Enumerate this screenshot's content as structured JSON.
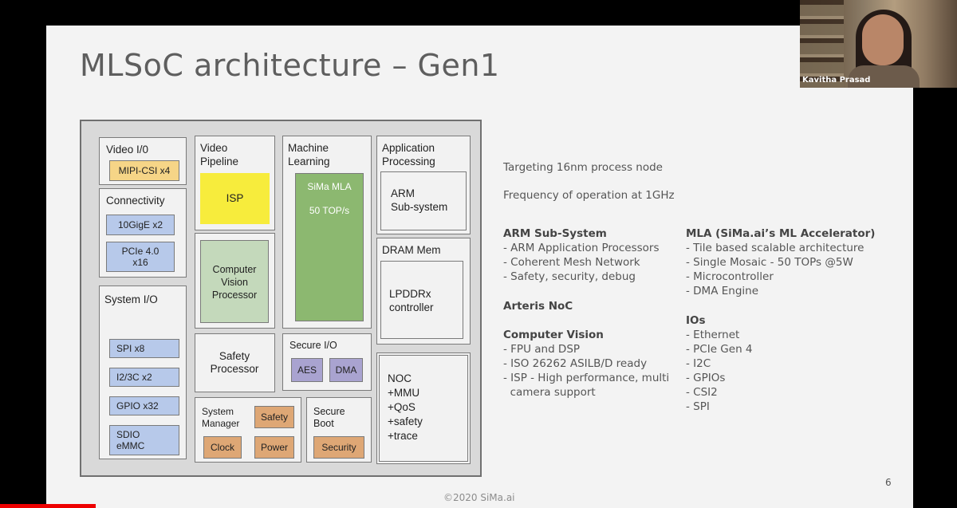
{
  "slide": {
    "title": "MLSoC architecture – Gen1",
    "footer": "©2020 SiMa.ai",
    "page_number": "6"
  },
  "diagram": {
    "video_io": {
      "label": "Video I/0",
      "chip": "MIPI-CSI x4"
    },
    "video_pipeline": {
      "label": "Video\nPipeline",
      "isp": "ISP"
    },
    "machine_learning": {
      "label": "Machine\nLearning",
      "mla_name": "SiMa MLA",
      "mla_tops": "50 TOP/s"
    },
    "application_processing": {
      "label": "Application\nProcessing",
      "arm": "ARM\nSub-system"
    },
    "connectivity": {
      "label": "Connectivity",
      "chips": [
        "10GigE x2",
        "PCIe 4.0\nx16"
      ]
    },
    "cv_processor": {
      "label": "Computer\nVision\nProcessor"
    },
    "dram_mem": {
      "label": "DRAM Mem",
      "controller": "LPDDRx\ncontroller"
    },
    "system_io": {
      "label": "System I/O",
      "chips": [
        "SPI x8",
        "I2/3C x2",
        "GPIO x32",
        "SDIO\neMMC"
      ]
    },
    "safety_processor": {
      "label": "Safety\nProcessor"
    },
    "secure_io": {
      "label": "Secure I/O",
      "chips": [
        "AES",
        "DMA"
      ]
    },
    "noc": {
      "label": "NOC\n+MMU\n+QoS\n+safety\n+trace"
    },
    "system_manager": {
      "label": "System\nManager",
      "chips": [
        "Safety",
        "Clock",
        "Power"
      ]
    },
    "secure_boot": {
      "label": "Secure\nBoot",
      "chip": "Security"
    }
  },
  "notes": {
    "line1": "Targeting 16nm process node",
    "line2": "Frequency of operation at 1GHz",
    "arm": {
      "head": "ARM Sub-System",
      "items": [
        "- ARM Application Processors",
        "- Coherent Mesh Network",
        "- Safety, security, debug"
      ]
    },
    "arteris": {
      "head": "Arteris NoC"
    },
    "cv": {
      "head": "Computer Vision",
      "items": [
        "- FPU and DSP",
        "- ISO 26262 ASILB/D ready",
        "- ISP - High performance, multi",
        "  camera support"
      ]
    },
    "mla": {
      "head": "MLA (SiMa.ai’s ML Accelerator)",
      "items": [
        "- Tile based scalable architecture",
        "- Single Mosaic - 50 TOPs @5W",
        "- Microcontroller",
        "- DMA Engine"
      ]
    },
    "ios": {
      "head": "IOs",
      "items": [
        "- Ethernet",
        "- PCIe Gen 4",
        "- I2C",
        "- GPIOs",
        "- CSI2",
        "- SPI"
      ]
    }
  },
  "webcam": {
    "name": "Kavitha Prasad"
  }
}
